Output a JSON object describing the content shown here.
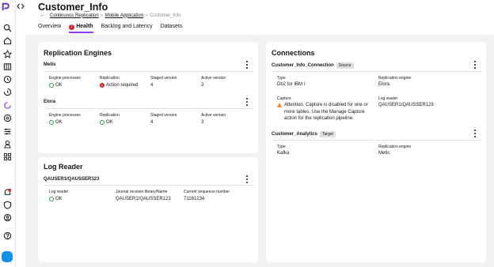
{
  "header": {
    "title": "Customer_Info",
    "breadcrumb": [
      "Continuous Replication",
      "Mobile Application",
      "Customer_Info"
    ],
    "breadcrumb_sep": "›"
  },
  "tabs": [
    {
      "label": "Overview",
      "active": false
    },
    {
      "label": "Health",
      "active": true,
      "alert": true
    },
    {
      "label": "Backlog and Latency",
      "active": false
    },
    {
      "label": "Datasets",
      "active": false
    }
  ],
  "replication_engines": {
    "title": "Replication Engines",
    "columns": [
      "Engine processes",
      "Replication",
      "Staged version",
      "Active version"
    ],
    "engines": [
      {
        "name": "Metis",
        "engine_processes": "OK",
        "replication": "Action required",
        "staged_version": "4",
        "active_version": "3"
      },
      {
        "name": "Elora",
        "engine_processes": "OK",
        "replication": "OK",
        "staged_version": "4",
        "active_version": "3"
      }
    ]
  },
  "log_reader": {
    "title": "Log Reader",
    "source": "QAUSER1/QAUSSER123",
    "columns": [
      "Log reader",
      "Journal receiver library/Name",
      "Current sequence number"
    ],
    "status": "OK",
    "journal": "QAUSER1/QAUSSER123",
    "sequence": "71161234"
  },
  "connections": {
    "title": "Connections",
    "items": [
      {
        "name": "Customer_Info_Connection",
        "tag": "Source",
        "type_label": "Type",
        "type": "Db2 for IBM i",
        "engine_label": "Replication engine",
        "engine": "Elora",
        "capture_label": "Capture",
        "capture": "Attention. Capture is disabled for one or more tables. Use the Manage Capture action for the replication pipeline.",
        "log_reader_label": "Log reader",
        "log_reader": "QAUSER1/QAUSSER123"
      },
      {
        "name": "Customer_Analytics",
        "tag": "Target",
        "type_label": "Type",
        "type": "Kafka",
        "engine_label": "Replication engine",
        "engine": "Metis"
      }
    ]
  },
  "colors": {
    "accent": "#8a3ffc",
    "ok": "#24a148",
    "error": "#da1e28",
    "warning": "#ff832b",
    "brand": "#6929c4"
  },
  "rail_icons": [
    "search-icon",
    "home-icon",
    "star-icon",
    "catalog-icon",
    "history-icon",
    "clock-icon",
    "replication-icon",
    "settings-icon",
    "sliders-icon",
    "deploy-icon",
    "apps-icon",
    "notification-icon",
    "shield-icon",
    "support-icon",
    "help-icon",
    "chat-icon"
  ]
}
